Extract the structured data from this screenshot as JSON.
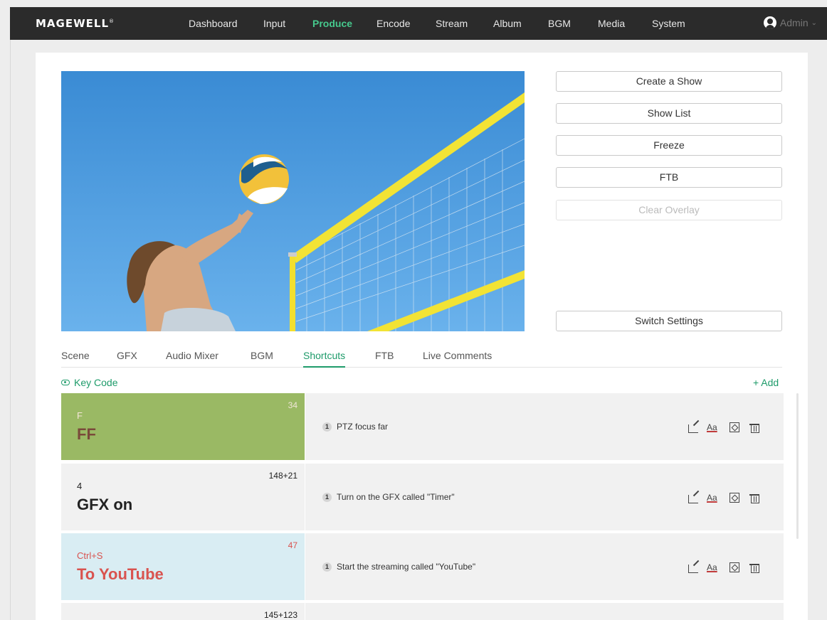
{
  "brand": {
    "logo": "MAGEWELL",
    "reg": "®"
  },
  "nav": {
    "items": [
      {
        "label": "Dashboard"
      },
      {
        "label": "Input"
      },
      {
        "label": "Produce",
        "active": true
      },
      {
        "label": "Encode"
      },
      {
        "label": "Stream"
      },
      {
        "label": "Album"
      },
      {
        "label": "BGM"
      },
      {
        "label": "Media"
      },
      {
        "label": "System"
      }
    ],
    "user": "Admin",
    "active_color": "#46c98d"
  },
  "controls": {
    "create_show": "Create a Show",
    "show_list": "Show List",
    "freeze": "Freeze",
    "ftb": "FTB",
    "clear_overlay": "Clear Overlay",
    "switch_settings": "Switch Settings"
  },
  "tabs": [
    {
      "label": "Scene"
    },
    {
      "label": "GFX"
    },
    {
      "label": "Audio Mixer"
    },
    {
      "label": "BGM"
    },
    {
      "label": "Shortcuts",
      "active": true
    },
    {
      "label": "FTB"
    },
    {
      "label": "Live Comments"
    }
  ],
  "shortcuts_toolbar": {
    "key_code": "Key Code",
    "add": "+ Add"
  },
  "shortcuts": [
    {
      "key": "F",
      "code": "34",
      "name": "FF",
      "action_index": "1",
      "action": "PTZ focus far",
      "bg": "#9ab964",
      "text_color": "#7a4a3a"
    },
    {
      "key": "4",
      "code": "148+21",
      "name": "GFX on",
      "action_index": "1",
      "action": "Turn on the GFX called \"Timer\"",
      "bg": "#f1f1f1",
      "text_color": "#222222"
    },
    {
      "key": "Ctrl+S",
      "code": "47",
      "name": "To YouTube",
      "action_index": "1",
      "action": "Start the streaming called \"YouTube\"",
      "bg": "#d9edf3",
      "text_color": "#d9534f"
    },
    {
      "key": "",
      "code": "145+123",
      "name": "",
      "action_index": "",
      "action": "",
      "bg": "#f1f1f1",
      "text_color": "#222222"
    }
  ],
  "icons": {
    "edit": "edit-icon",
    "font": "Aa",
    "fill": "fill-color-icon",
    "delete": "trash-icon"
  }
}
